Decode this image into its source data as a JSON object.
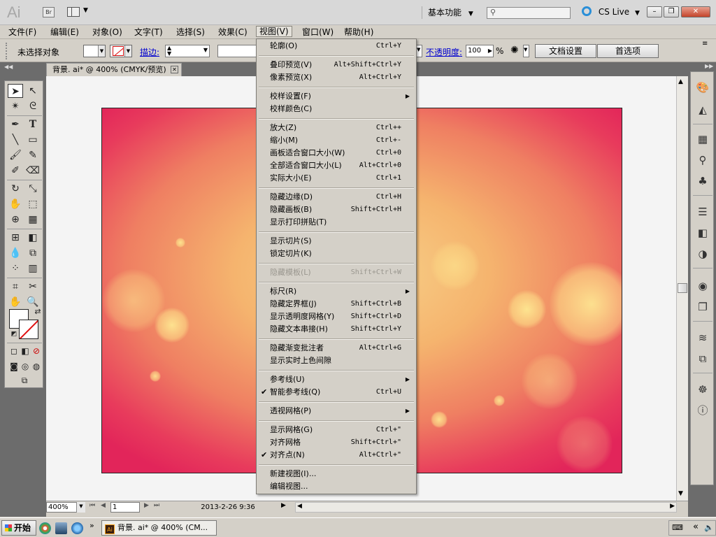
{
  "titlebar": {
    "app_logo": "Ai",
    "bridge_label": "Br",
    "workspace": "基本功能",
    "cs_live": "CS Live",
    "min": "–",
    "restore": "❐",
    "close": "✕"
  },
  "menubar": {
    "items": [
      {
        "label": "文件(F)"
      },
      {
        "label": "编辑(E)"
      },
      {
        "label": "对象(O)"
      },
      {
        "label": "文字(T)"
      },
      {
        "label": "选择(S)"
      },
      {
        "label": "效果(C)"
      },
      {
        "label": "视图(V)"
      },
      {
        "label": "窗口(W)"
      },
      {
        "label": "帮助(H)"
      }
    ]
  },
  "controlbar": {
    "no_selection": "未选择对象",
    "stroke_label": "描边:",
    "opacity_label": "不透明度:",
    "opacity_value": "100",
    "opacity_unit": "%",
    "doc_setup": "文档设置",
    "preferences": "首选项"
  },
  "document": {
    "tab_title": "背景. ai* @ 400% (CMYK/预览)",
    "tab_close": "✕"
  },
  "statusbar": {
    "zoom": "400%",
    "page": "1",
    "date": "2013-2-26  9:36"
  },
  "view_menu": {
    "items": [
      {
        "label": "轮廓(O)",
        "shortcut": "Ctrl+Y"
      },
      {
        "label": "叠印预览(V)",
        "shortcut": "Alt+Shift+Ctrl+Y"
      },
      {
        "label": "像素预览(X)",
        "shortcut": "Alt+Ctrl+Y"
      },
      {
        "label": "校样设置(F)",
        "shortcut": ""
      },
      {
        "label": "校样颜色(C)",
        "shortcut": ""
      },
      {
        "label": "放大(Z)",
        "shortcut": "Ctrl++"
      },
      {
        "label": "缩小(M)",
        "shortcut": "Ctrl+-"
      },
      {
        "label": "画板适合窗口大小(W)",
        "shortcut": "Ctrl+0"
      },
      {
        "label": "全部适合窗口大小(L)",
        "shortcut": "Alt+Ctrl+0"
      },
      {
        "label": "实际大小(E)",
        "shortcut": "Ctrl+1"
      },
      {
        "label": "隐藏边缘(D)",
        "shortcut": "Ctrl+H"
      },
      {
        "label": "隐藏画板(B)",
        "shortcut": "Shift+Ctrl+H"
      },
      {
        "label": "显示打印拼贴(T)",
        "shortcut": ""
      },
      {
        "label": "显示切片(S)",
        "shortcut": ""
      },
      {
        "label": "锁定切片(K)",
        "shortcut": ""
      },
      {
        "label": "隐藏模板(L)",
        "shortcut": "Shift+Ctrl+W"
      },
      {
        "label": "标尺(R)",
        "shortcut": ""
      },
      {
        "label": "隐藏定界框(J)",
        "shortcut": "Shift+Ctrl+B"
      },
      {
        "label": "显示透明度网格(Y)",
        "shortcut": "Shift+Ctrl+D"
      },
      {
        "label": "隐藏文本串接(H)",
        "shortcut": "Shift+Ctrl+Y"
      },
      {
        "label": "隐藏渐变批注者",
        "shortcut": "Alt+Ctrl+G"
      },
      {
        "label": "显示实时上色间隙",
        "shortcut": ""
      },
      {
        "label": "参考线(U)",
        "shortcut": ""
      },
      {
        "label": "智能参考线(Q)",
        "shortcut": "Ctrl+U"
      },
      {
        "label": "透视网格(P)",
        "shortcut": ""
      },
      {
        "label": "显示网格(G)",
        "shortcut": "Ctrl+\""
      },
      {
        "label": "对齐网格",
        "shortcut": "Shift+Ctrl+\""
      },
      {
        "label": "对齐点(N)",
        "shortcut": "Alt+Ctrl+\""
      },
      {
        "label": "新建视图(I)...",
        "shortcut": ""
      },
      {
        "label": "编辑视图...",
        "shortcut": ""
      }
    ]
  },
  "taskbar": {
    "start": "开始",
    "task_title": "背景. ai* @ 400% (CM..."
  }
}
